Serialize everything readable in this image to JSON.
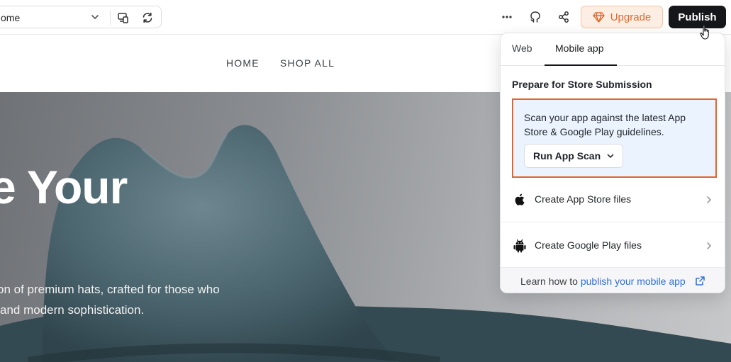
{
  "toolbar": {
    "page_select_value": "ome",
    "upgrade_label": "Upgrade",
    "publish_label": "Publish",
    "colors": {
      "upgrade": "#e36a2e",
      "publish_bg": "#16171a"
    }
  },
  "site": {
    "nav": [
      "HOME",
      "SHOP ALL"
    ],
    "hero_title": "e Your",
    "hero_sub_line1": "on of premium hats, crafted for those who",
    "hero_sub_line2": "and modern sophistication."
  },
  "publish_panel": {
    "tabs": [
      {
        "label": "Web",
        "active": false
      },
      {
        "label": "Mobile app",
        "active": true
      }
    ],
    "section_title": "Prepare for Store Submission",
    "scan": {
      "text": "Scan your app against the latest App Store & Google Play guidelines.",
      "button_label": "Run App Scan",
      "highlight_color": "#e3652a"
    },
    "rows": [
      {
        "label": "Create App Store files",
        "icon": "apple-icon"
      },
      {
        "label": "Create Google Play files",
        "icon": "android-icon"
      }
    ],
    "footer": {
      "prefix": "Learn how to ",
      "link_text": "publish your mobile app",
      "icon": "external-link-icon"
    }
  }
}
